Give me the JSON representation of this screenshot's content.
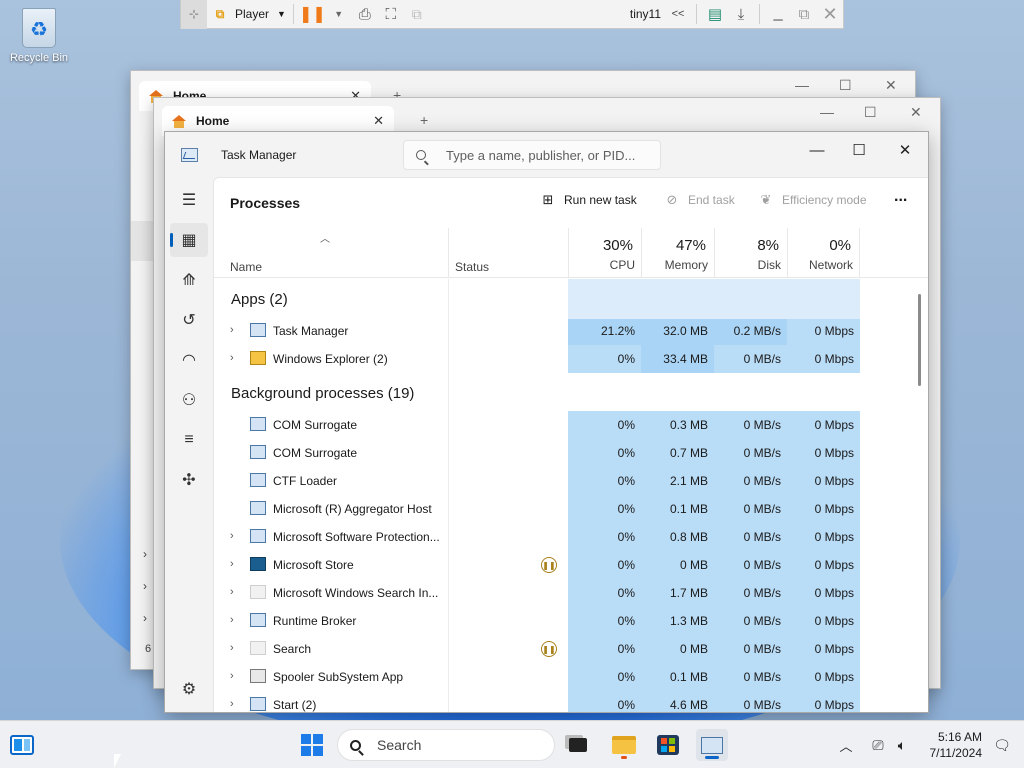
{
  "desktop": {
    "recycle_bin_label": "Recycle Bin"
  },
  "vm_toolbar": {
    "player_label": "Player",
    "vm_name": "tiny11",
    "collapse": "<<"
  },
  "back_windows": {
    "tab1": "Home",
    "tab2": "Home",
    "newtab": "+",
    "left_items": [
      "›",
      "›",
      "›"
    ],
    "status_fragment": "6 i"
  },
  "task_manager": {
    "window_title": "Task Manager",
    "search_placeholder": "Type a name, publisher, or PID...",
    "page_title": "Processes",
    "toolbar": {
      "run_new_task": "Run new task",
      "end_task": "End task",
      "efficiency_mode": "Efficiency mode",
      "more": "..."
    },
    "columns": {
      "name": "Name",
      "status": "Status",
      "cpu_pct": "30%",
      "cpu": "CPU",
      "memory_pct": "47%",
      "memory": "Memory",
      "disk_pct": "8%",
      "disk": "Disk",
      "network_pct": "0%",
      "network": "Network"
    },
    "groups": {
      "apps": "Apps (2)",
      "background": "Background processes (19)"
    },
    "apps": [
      {
        "name": "Task Manager",
        "cpu": "21.2%",
        "memory": "32.0 MB",
        "disk": "0.2 MB/s",
        "network": "0 Mbps"
      },
      {
        "name": "Windows Explorer (2)",
        "cpu": "0%",
        "memory": "33.4 MB",
        "disk": "0 MB/s",
        "network": "0 Mbps"
      }
    ],
    "background": [
      {
        "name": "COM Surrogate",
        "cpu": "0%",
        "memory": "0.3 MB",
        "disk": "0 MB/s",
        "network": "0 Mbps"
      },
      {
        "name": "COM Surrogate",
        "cpu": "0%",
        "memory": "0.7 MB",
        "disk": "0 MB/s",
        "network": "0 Mbps"
      },
      {
        "name": "CTF Loader",
        "cpu": "0%",
        "memory": "2.1 MB",
        "disk": "0 MB/s",
        "network": "0 Mbps"
      },
      {
        "name": "Microsoft (R) Aggregator Host",
        "cpu": "0%",
        "memory": "0.1 MB",
        "disk": "0 MB/s",
        "network": "0 Mbps"
      },
      {
        "name": "Microsoft Software Protection...",
        "cpu": "0%",
        "memory": "0.8 MB",
        "disk": "0 MB/s",
        "network": "0 Mbps"
      },
      {
        "name": "Microsoft Store",
        "cpu": "0%",
        "memory": "0 MB",
        "disk": "0 MB/s",
        "network": "0 Mbps"
      },
      {
        "name": "Microsoft Windows Search In...",
        "cpu": "0%",
        "memory": "1.7 MB",
        "disk": "0 MB/s",
        "network": "0 Mbps"
      },
      {
        "name": "Runtime Broker",
        "cpu": "0%",
        "memory": "1.3 MB",
        "disk": "0 MB/s",
        "network": "0 Mbps"
      },
      {
        "name": "Search",
        "cpu": "0%",
        "memory": "0 MB",
        "disk": "0 MB/s",
        "network": "0 Mbps"
      },
      {
        "name": "Spooler SubSystem App",
        "cpu": "0%",
        "memory": "0.1 MB",
        "disk": "0 MB/s",
        "network": "0 Mbps"
      },
      {
        "name": "Start (2)",
        "cpu": "0%",
        "memory": "4.6 MB",
        "disk": "0 MB/s",
        "network": "0 Mbps"
      }
    ]
  },
  "taskbar": {
    "search_label": "Search",
    "time": "5:16 AM",
    "date": "7/11/2024"
  },
  "colors": {
    "heat_light": "#dcecfb",
    "heat_mid": "#b9dcf7",
    "heat_high": "#a9d4f5",
    "accent": "#005fb8"
  }
}
